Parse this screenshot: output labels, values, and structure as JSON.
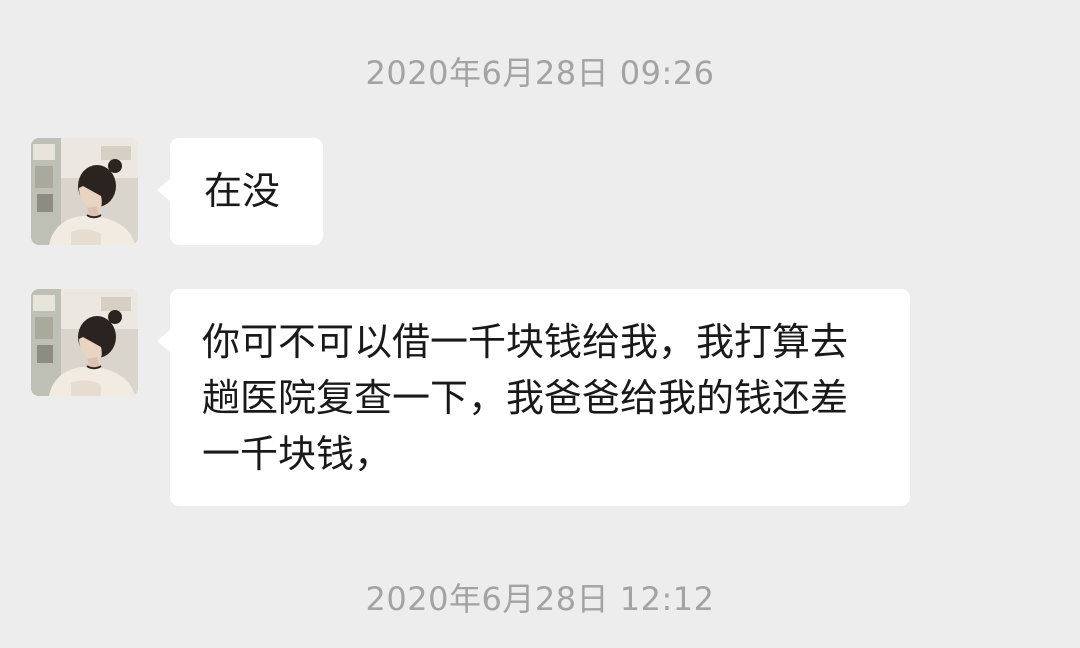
{
  "chat": {
    "timestamps": [
      "2020年6月28日 09:26",
      "2020年6月28日 12:12"
    ],
    "messages": [
      {
        "sender": "contact",
        "avatar_icon": "girl-photo-avatar",
        "text": "在没"
      },
      {
        "sender": "contact",
        "avatar_icon": "girl-photo-avatar",
        "text": "你可不可以借一千块钱给我，我打算去趟医院复查一下，我爸爸给我的钱还差一千块钱，"
      }
    ]
  },
  "colors": {
    "background": "#ededed",
    "bubble": "#ffffff",
    "timestamp_text": "#a3a3a3",
    "message_text": "#191919"
  }
}
